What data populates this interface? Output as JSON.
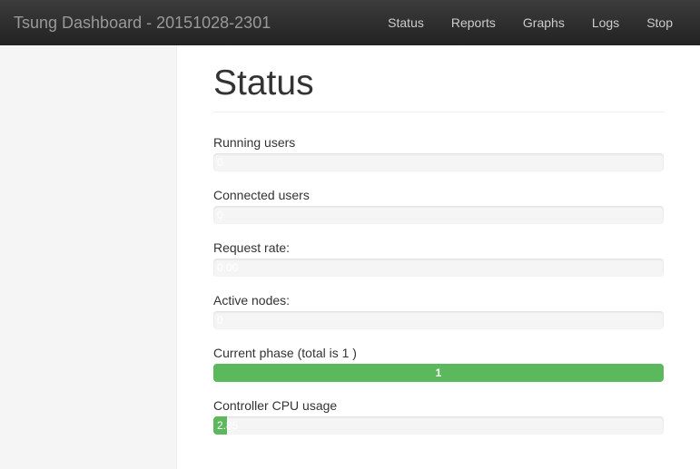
{
  "header": {
    "brand": "Tsung Dashboard - 20151028-2301",
    "nav": [
      {
        "label": "Status"
      },
      {
        "label": "Reports"
      },
      {
        "label": "Graphs"
      },
      {
        "label": "Logs"
      },
      {
        "label": "Stop"
      }
    ]
  },
  "page": {
    "title": "Status"
  },
  "metrics": {
    "running_users": {
      "label": "Running users",
      "value": "0",
      "percent": 0
    },
    "connected_users": {
      "label": "Connected users",
      "value": "0",
      "percent": 0
    },
    "request_rate": {
      "label": "Request rate:",
      "value": "0.00",
      "percent": 0
    },
    "active_nodes": {
      "label": "Active nodes:",
      "value": "0",
      "percent": 0
    },
    "current_phase": {
      "label": "Current phase (total is 1 )",
      "value": "1",
      "percent": 100
    },
    "controller_cpu": {
      "label": "Controller CPU usage",
      "value": "2.85",
      "percent": 3
    }
  }
}
